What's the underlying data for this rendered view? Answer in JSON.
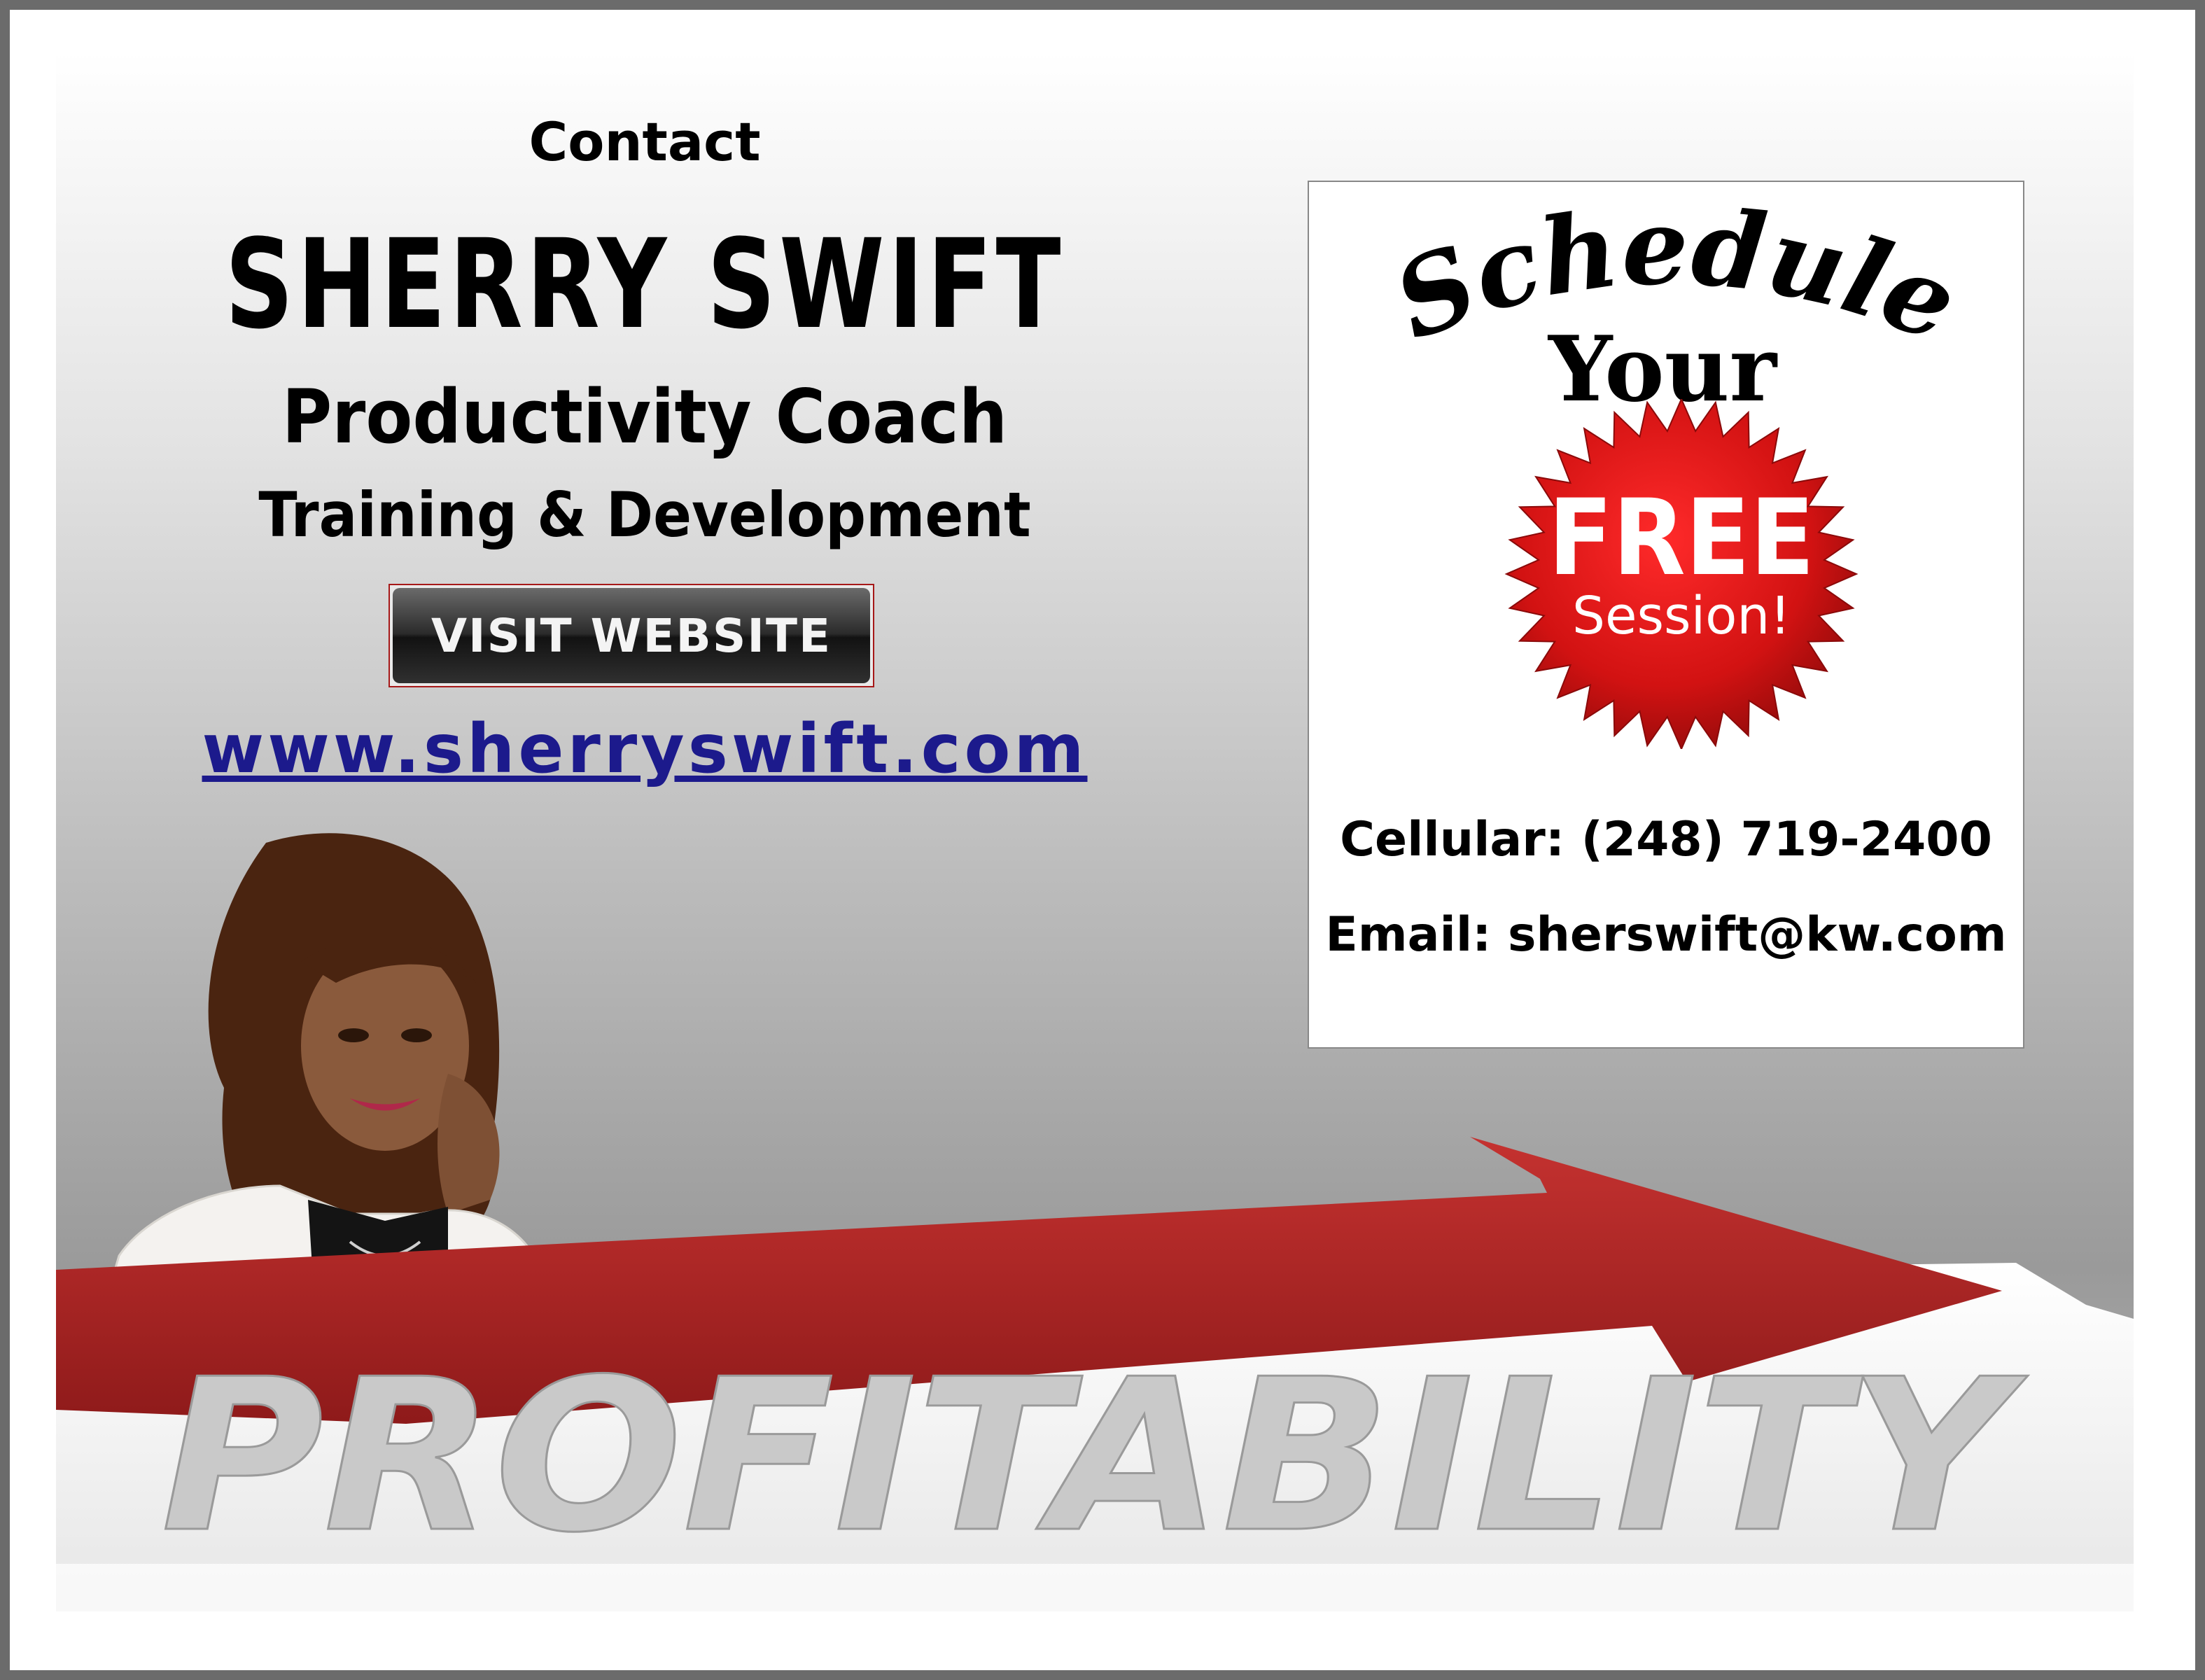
{
  "contact_heading": "Contact",
  "name": "SHERRY SWIFT",
  "title": "Productivity Coach",
  "subtitle": "Training & Development",
  "visit_button_label": "VISIT WEBSITE",
  "website_url": "www.sherryswift.com",
  "promo": {
    "headline_word_1": "Schedule",
    "headline_word_2": "Your",
    "badge_line_1": "FREE",
    "badge_line_2": "Session!",
    "cellular": "Cellular: (248) 719-2400",
    "email": "Email:  sherswift@kw.com"
  },
  "banner_text": "PROFITABILITY",
  "colors": {
    "frame": "#6b6b6b",
    "link": "#1c1a8c",
    "badge_red": "#d21212",
    "arrow_red": "#a3201f"
  }
}
